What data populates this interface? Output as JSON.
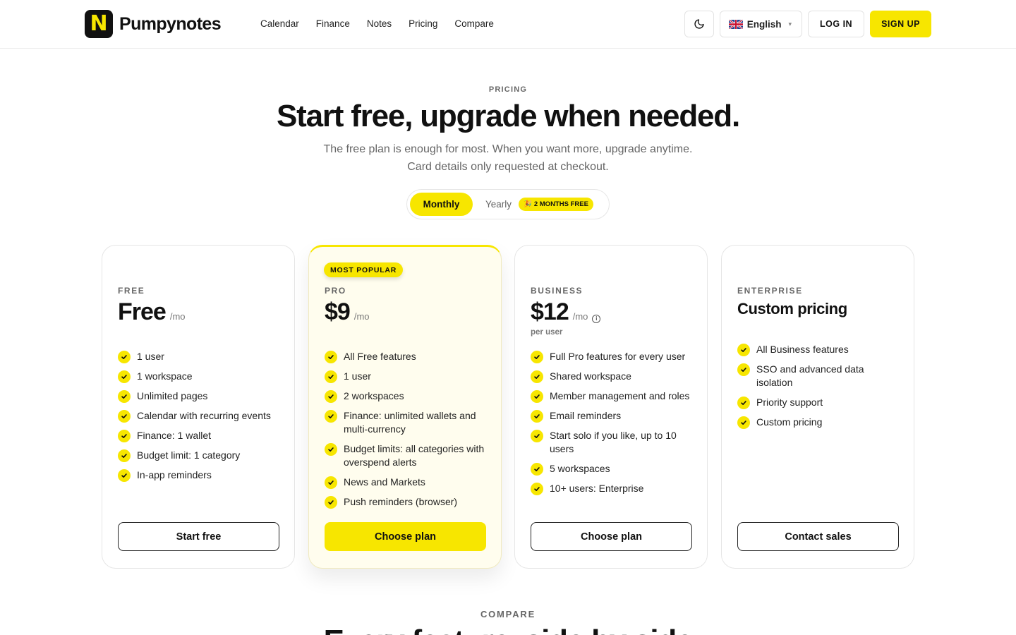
{
  "header": {
    "brand": {
      "logo_letter": "N",
      "name": "Pumpynotes"
    },
    "nav": [
      "Calendar",
      "Finance",
      "Notes",
      "Pricing",
      "Compare"
    ],
    "language": "English",
    "login_label": "LOG IN",
    "signup_label": "SIGN UP"
  },
  "hero": {
    "eyebrow": "PRICING",
    "title": "Start free, upgrade when needed.",
    "subtitle_line1": "The free plan is enough for most. When you want more, upgrade anytime.",
    "subtitle_line2": "Card details only requested at checkout."
  },
  "billing_toggle": {
    "monthly_label": "Monthly",
    "yearly_label": "Yearly",
    "badge_emoji": "🎉",
    "badge_text": "2 MONTHS FREE",
    "selected": "Monthly"
  },
  "plans": [
    {
      "tier": "FREE",
      "price": "Free",
      "unit": "/mo",
      "features": [
        "1 user",
        "1 workspace",
        "Unlimited pages",
        "Calendar with recurring events",
        "Finance: 1 wallet",
        "Budget limit: 1 category",
        "In-app reminders"
      ],
      "cta": "Start free"
    },
    {
      "badge": "MOST POPULAR",
      "tier": "PRO",
      "price": "$9",
      "unit": "/mo",
      "features": [
        "All Free features",
        "1 user",
        "2 workspaces",
        "Finance: unlimited wallets and multi-currency",
        "Budget limits: all categories with overspend alerts",
        "News and Markets",
        "Push reminders (browser)"
      ],
      "cta": "Choose plan"
    },
    {
      "tier": "BUSINESS",
      "price": "$12",
      "unit": "/mo",
      "note": "per user",
      "features": [
        "Full Pro features for every user",
        "Shared workspace",
        "Member management and roles",
        "Email reminders",
        "Start solo if you like, up to 10 users",
        "5 workspaces",
        "10+ users: Enterprise"
      ],
      "cta": "Choose plan"
    },
    {
      "tier": "ENTERPRISE",
      "price": "Custom pricing",
      "features": [
        "All Business features",
        "SSO and advanced data isolation",
        "Priority support",
        "Custom pricing"
      ],
      "cta": "Contact sales"
    }
  ],
  "compare": {
    "eyebrow": "COMPARE",
    "title": "Every feature, side by side"
  },
  "colors": {
    "accent": "#f7e600",
    "text": "#111111",
    "muted": "#666666",
    "border": "#e6e6e6",
    "popular_bg": "#fffdee"
  }
}
